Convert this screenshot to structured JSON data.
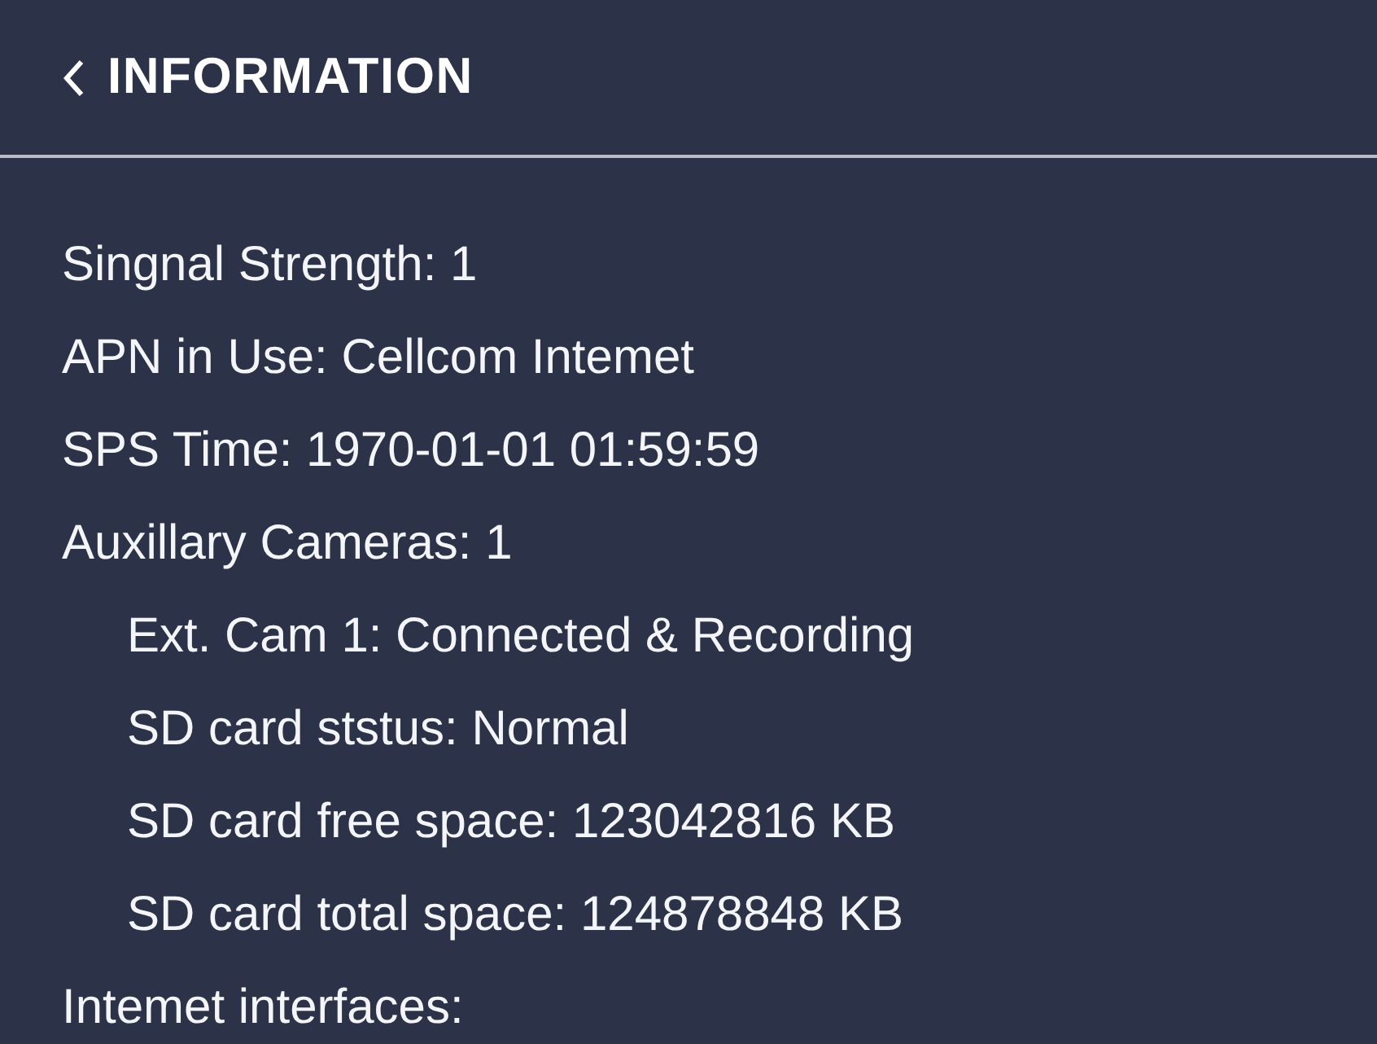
{
  "header": {
    "title": "INFORMATION"
  },
  "items": [
    {
      "text": "Singnal Strength: 1"
    },
    {
      "text": "APN in Use: Cellcom Intemet"
    },
    {
      "text": "SPS Time: 1970-01-01 01:59:59"
    },
    {
      "text": "Auxillary Cameras: 1",
      "children": [
        {
          "text": "Ext. Cam 1: Connected & Recording"
        },
        {
          "text": "SD card ststus: Normal"
        },
        {
          "text": "SD card free space: 123042816 KB"
        },
        {
          "text": "SD card total space: 124878848 KB"
        }
      ]
    },
    {
      "text": "Intemet interfaces:"
    }
  ]
}
